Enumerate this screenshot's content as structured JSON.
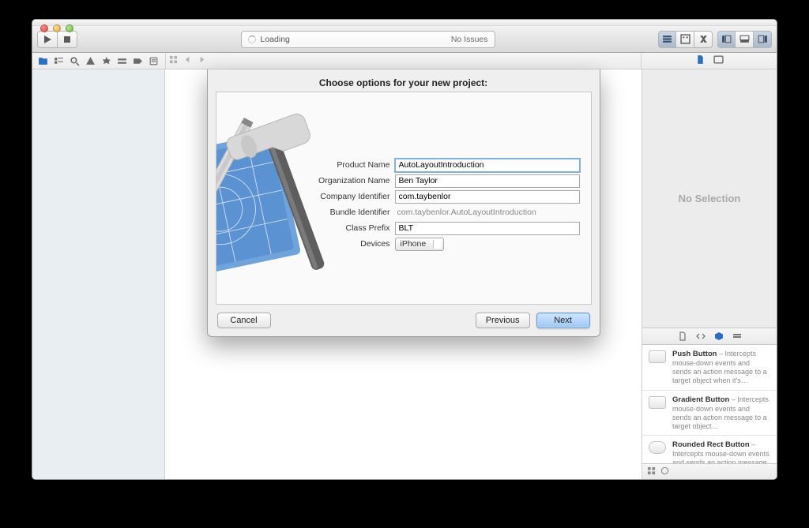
{
  "toolbar": {
    "status_loading": "Loading",
    "status_issues": "No Issues"
  },
  "inspector": {
    "empty": "No Selection"
  },
  "dialog": {
    "title": "Choose options for your new project:",
    "labels": {
      "product_name": "Product Name",
      "org_name": "Organization Name",
      "company_id": "Company Identifier",
      "bundle_id": "Bundle Identifier",
      "class_prefix": "Class Prefix",
      "devices": "Devices"
    },
    "values": {
      "product_name": "AutoLayoutIntroduction",
      "org_name": "Ben Taylor",
      "company_id": "com.taybenlor",
      "bundle_id": "com.taybenlor.AutoLayoutIntroduction",
      "class_prefix": "BLT",
      "devices": "iPhone"
    },
    "buttons": {
      "cancel": "Cancel",
      "previous": "Previous",
      "next": "Next"
    }
  },
  "library": {
    "items": [
      {
        "title": "Push Button",
        "desc": " – Intercepts mouse-down events and sends an action message to a target object when it's…"
      },
      {
        "title": "Gradient Button",
        "desc": " – Intercepts mouse-down events and sends an action message to a target object…"
      },
      {
        "title": "Rounded Rect Button",
        "desc": " – Intercepts mouse-down events and sends an action message to a target object…"
      }
    ]
  }
}
